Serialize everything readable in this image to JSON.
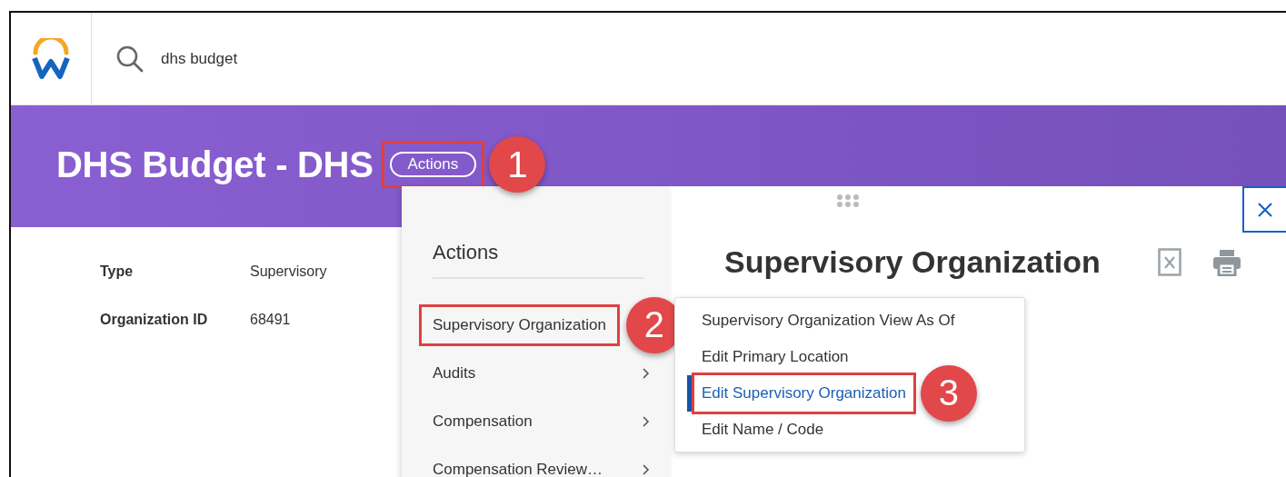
{
  "header": {
    "search": {
      "value": "dhs budget"
    }
  },
  "banner": {
    "title": "DHS Budget - DHS",
    "actions_button": {
      "label": "Actions",
      "callout": "1"
    }
  },
  "fields": [
    {
      "label": "Type",
      "value": "Supervisory"
    },
    {
      "label": "Organization ID",
      "value": "68491"
    }
  ],
  "actions_menu": {
    "title": "Actions",
    "items": [
      {
        "label": "Supervisory Organization",
        "has_submenu": false,
        "callout": "2"
      },
      {
        "label": "Audits",
        "has_submenu": true
      },
      {
        "label": "Compensation",
        "has_submenu": true
      },
      {
        "label": "Compensation Review…",
        "has_submenu": true
      }
    ]
  },
  "panel": {
    "title": "Supervisory Organization"
  },
  "submenu": {
    "items": [
      {
        "label": "Supervisory Organization View As Of",
        "selected": false
      },
      {
        "label": "Edit Primary Location",
        "selected": false
      },
      {
        "label": "Edit Supervisory Organization",
        "selected": true,
        "callout": "3"
      },
      {
        "label": "Edit Name / Code",
        "selected": false
      }
    ]
  }
}
